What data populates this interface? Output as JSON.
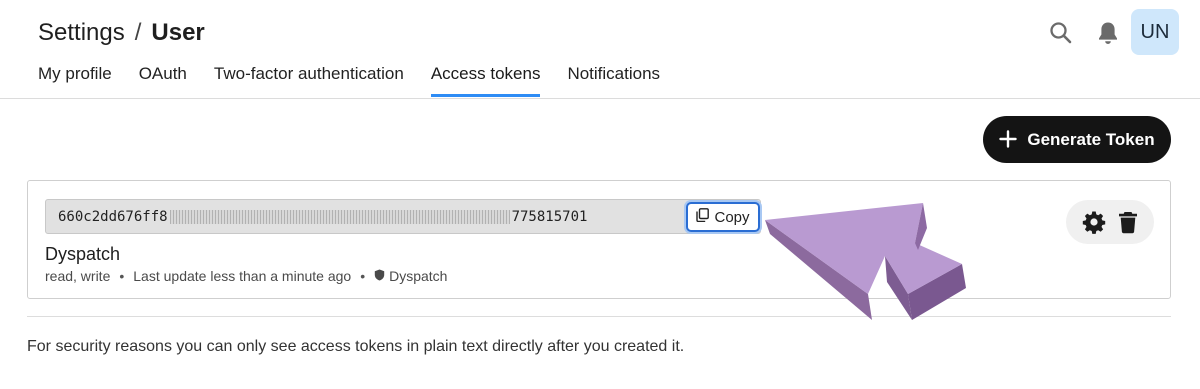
{
  "header": {
    "breadcrumb": {
      "parent": "Settings",
      "separator": "/",
      "current": "User"
    },
    "avatar_initials": "UN",
    "icons": {
      "search": "search-icon",
      "notifications": "bell-icon"
    }
  },
  "tabs": [
    {
      "label": "My profile",
      "active": false
    },
    {
      "label": "OAuth",
      "active": false
    },
    {
      "label": "Two-factor authentication",
      "active": false
    },
    {
      "label": "Access tokens",
      "active": true
    },
    {
      "label": "Notifications",
      "active": false
    }
  ],
  "toolbar": {
    "generate_label": "Generate Token"
  },
  "token": {
    "prefix": "660c2dd676ff8",
    "suffix": "775815701",
    "copy_label": "Copy",
    "name": "Dyspatch",
    "scopes": "read, write",
    "last_update": "Last update less than a minute ago",
    "owner": "Dyspatch"
  },
  "footer": {
    "note": "For security reasons you can only see access tokens in plain text directly after you created it."
  },
  "colors": {
    "accent": "#2e8cf5",
    "primary_button": "#141414",
    "arrow": "#b795cf",
    "avatar_bg": "#cfe7fb"
  }
}
